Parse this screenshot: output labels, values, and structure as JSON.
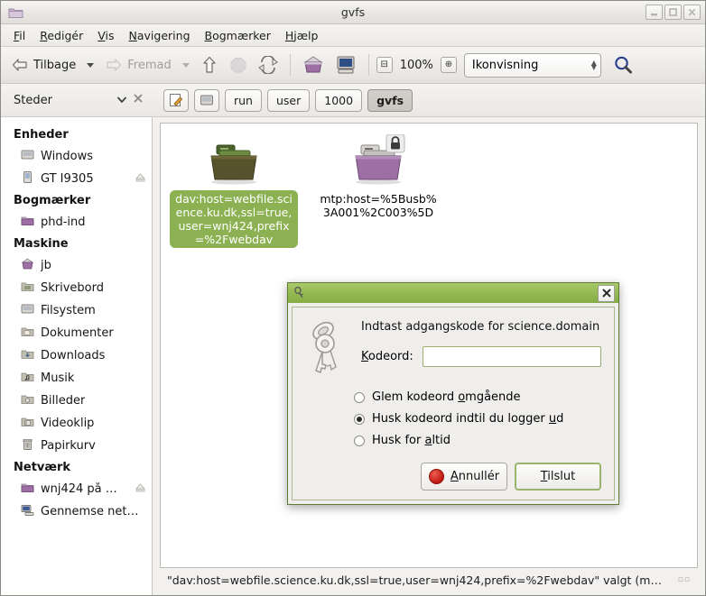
{
  "window": {
    "title": "gvfs",
    "icon": "folder-icon",
    "buttons": [
      {
        "name": "minimize-button",
        "glyph": "minimize-icon"
      },
      {
        "name": "maximize-button",
        "glyph": "maximize-icon"
      },
      {
        "name": "close-button",
        "glyph": "close-icon"
      }
    ]
  },
  "menubar": [
    {
      "label": "Fil",
      "mnemonic": "F"
    },
    {
      "label": "Redigér",
      "mnemonic": "R"
    },
    {
      "label": "Vis",
      "mnemonic": "V"
    },
    {
      "label": "Navigering",
      "mnemonic": "N"
    },
    {
      "label": "Bogmærker",
      "mnemonic": "B"
    },
    {
      "label": "Hjælp",
      "mnemonic": "H"
    }
  ],
  "toolbar": {
    "back_label": "Tilbage",
    "forward_label": "Fremad",
    "up_icon": "arrow-up-icon",
    "stop_icon": "stop-icon",
    "reload_icon": "reload-icon",
    "home_icon": "home-folder-icon",
    "computer_icon": "computer-icon",
    "zoom_out_icon": "zoom-out-icon",
    "zoom_level": "100%",
    "zoom_in_icon": "zoom-in-icon",
    "view_mode": "Ikonvisning",
    "search_icon": "search-icon"
  },
  "places": {
    "title": "Steder",
    "collapse_icon": "chevron-down-icon",
    "close_icon": "close-pane-icon"
  },
  "breadcrumbs": {
    "edit_icon": "edit-location-icon",
    "filesystem_icon": "filesystem-icon",
    "items": [
      {
        "label": "run",
        "active": false
      },
      {
        "label": "user",
        "active": false
      },
      {
        "label": "1000",
        "active": false
      },
      {
        "label": "gvfs",
        "active": true
      }
    ]
  },
  "sidebar": {
    "groups": [
      {
        "title": "Enheder",
        "items": [
          {
            "label": "Windows",
            "icon": "drive-harddisk-icon",
            "eject": false
          },
          {
            "label": "GT I9305",
            "icon": "phone-icon",
            "eject": true
          }
        ]
      },
      {
        "title": "Bogmærker",
        "items": [
          {
            "label": "phd-ind",
            "icon": "folder-purple-icon",
            "eject": false
          }
        ]
      },
      {
        "title": "Maskine",
        "items": [
          {
            "label": "jb",
            "icon": "home-folder-icon",
            "eject": false
          },
          {
            "label": "Skrivebord",
            "icon": "folder-desktop-icon",
            "eject": false
          },
          {
            "label": "Filsystem",
            "icon": "drive-harddisk-icon",
            "eject": false
          },
          {
            "label": "Dokumenter",
            "icon": "folder-documents-icon",
            "eject": false
          },
          {
            "label": "Downloads",
            "icon": "folder-downloads-icon",
            "eject": false
          },
          {
            "label": "Musik",
            "icon": "folder-music-icon",
            "eject": false
          },
          {
            "label": "Billeder",
            "icon": "folder-pictures-icon",
            "eject": false
          },
          {
            "label": "Videoklip",
            "icon": "folder-videos-icon",
            "eject": false
          },
          {
            "label": "Papirkurv",
            "icon": "trash-icon",
            "eject": false
          }
        ]
      },
      {
        "title": "Netværk",
        "items": [
          {
            "label": "wnj424 på …",
            "icon": "folder-remote-icon",
            "eject": true
          },
          {
            "label": "Gennemse net…",
            "icon": "network-icon",
            "eject": false
          }
        ]
      }
    ]
  },
  "files": [
    {
      "name": "dav:host=webfile.science.ku.dk,ssl=true,user=wnj424,prefix=%2Fwebdav",
      "icon": "folder-olive-icon",
      "selected": true,
      "locked": false
    },
    {
      "name": "mtp:host=%5Busb%3A001%2C003%5D",
      "icon": "folder-purple-icon",
      "selected": false,
      "locked": true
    }
  ],
  "statusbar": {
    "text": "\"dav:host=webfile.science.ku.dk,ssl=true,user=wnj424,prefix=%2Fwebdav\" valgt (m…"
  },
  "dialog": {
    "title_icon": "key-small-icon",
    "close_icon": "close-icon",
    "key_icon": "keyring-icon",
    "heading": "Indtast adgangskode for science.domain",
    "password_label": "Kodeord:",
    "password_value": "",
    "password_mnemonic": "K",
    "options": [
      {
        "label": "Glem kodeord omgående",
        "selected": false,
        "mnemonic": "o"
      },
      {
        "label": "Husk kodeord indtil du logger ud",
        "selected": true,
        "mnemonic": "u"
      },
      {
        "label": "Husk for altid",
        "selected": false,
        "mnemonic": "a"
      }
    ],
    "cancel_label": "Annullér",
    "cancel_mnemonic": "A",
    "connect_label": "Tilslut",
    "connect_mnemonic": "T"
  },
  "colors": {
    "selection_green": "#8cb152",
    "dialog_title_green": "#92b851",
    "folder_purple": "#9d6fa4",
    "folder_olive": "#5d5a31"
  }
}
